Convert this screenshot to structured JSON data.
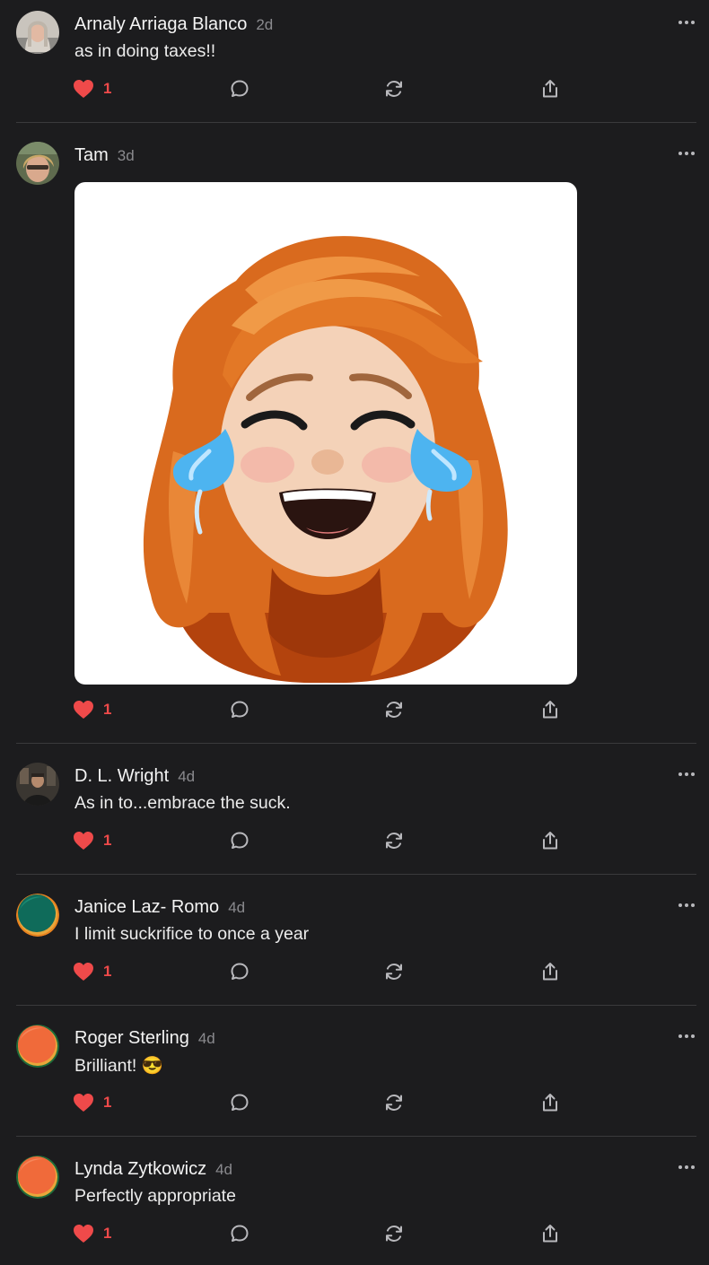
{
  "posts": [
    {
      "author": "Arnaly Arriaga Blanco",
      "time": "2d",
      "text": "as in doing taxes!!",
      "likes": "1",
      "avatar_icon": "person-photo-grey-hair"
    },
    {
      "author": "Tam",
      "time": "3d",
      "text": "",
      "likes": "1",
      "avatar_icon": "person-photo-blonde",
      "image_icon": "memoji-tears-of-joy-red-hair"
    },
    {
      "author": "D. L. Wright",
      "time": "4d",
      "text": "As in to...embrace the suck.",
      "likes": "1",
      "avatar_icon": "person-photo-dark"
    },
    {
      "author": "Janice Laz- Romo",
      "time": "4d",
      "text": "I limit suckrifice to once a year",
      "likes": "1",
      "avatar_icon": "default-avatar-teal"
    },
    {
      "author": "Roger Sterling",
      "time": "4d",
      "text": "Brilliant! 😎",
      "likes": "1",
      "avatar_icon": "default-avatar-orange"
    },
    {
      "author": "Lynda Zytkowicz",
      "time": "4d",
      "text": "Perfectly appropriate",
      "likes": "1",
      "avatar_icon": "default-avatar-orange"
    }
  ],
  "colors": {
    "background": "#1c1c1e",
    "like_red": "#ef4a4a",
    "icon_grey": "#b8b8bc",
    "divider": "#3a3a3c",
    "time_grey": "#8a8a8e"
  }
}
